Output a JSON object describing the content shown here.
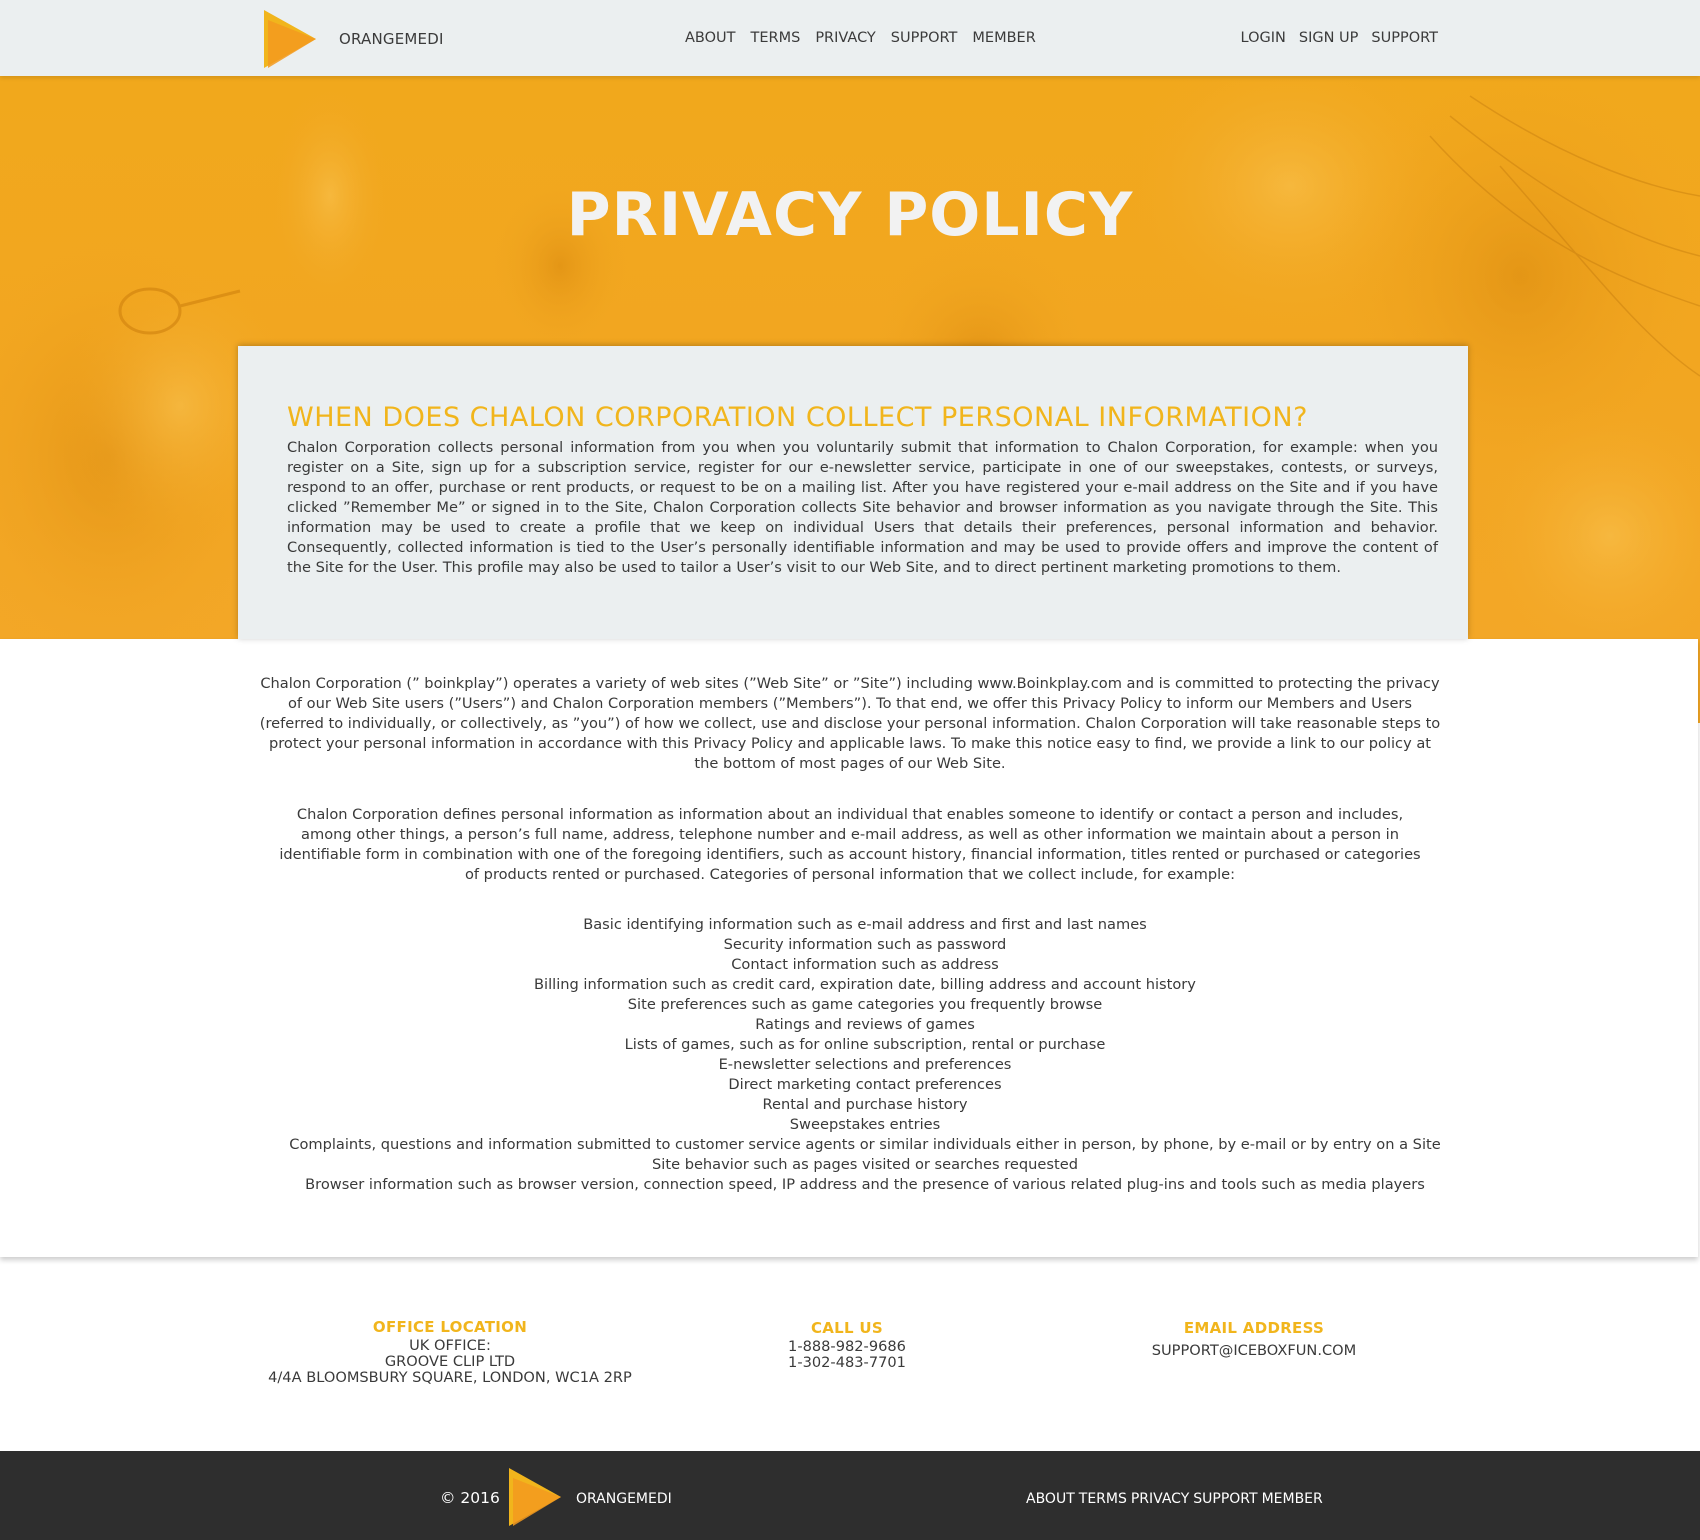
{
  "header": {
    "brand": "ORANGEMEDI",
    "nav_main": [
      "ABOUT",
      "TERMS",
      "PRIVACY",
      "SUPPORT",
      "MEMBER"
    ],
    "nav_right": [
      "LOGIN",
      "SIGN UP",
      "SUPPORT"
    ]
  },
  "hero": {
    "title": "PRIVACY POLICY"
  },
  "intro": {
    "heading": "WHEN DOES CHALON CORPORATION COLLECT PERSONAL INFORMATION?",
    "text": "Chalon Corporation collects personal information from you when you voluntarily submit that information to Chalon Corporation, for example: when you register on a Site, sign up for a subscription service, register for our e-newsletter service, participate in one of our sweepstakes, contests, or surveys, respond to an offer, purchase or rent products, or request to be on a mailing list. After you have registered your e-mail address on the Site and if you have clicked ”Remember Me” or signed in to the Site, Chalon Corporation collects Site behavior and browser information as you navigate through the Site. This information may be used to create a profile that we keep on individual Users that details their preferences, personal information and behavior. Consequently, collected information is tied to the User’s personally identifiable information and may be used to provide offers and improve the content of the Site for the User. This profile may also be used to tailor a User’s visit to our Web Site, and to direct pertinent marketing promotions to them."
  },
  "body": {
    "paragraph_1": "Chalon Corporation (” boinkplay”) operates a variety of web sites (”Web Site” or ”Site”) including www.Boinkplay.com and is committed to protecting the privacy of our Web Site users (”Users”) and Chalon Corporation members (”Members”). To that end, we offer this Privacy Policy to inform our Members and Users (referred to individually, or collectively, as ”you”) of how we collect, use and disclose your personal information. Chalon Corporation will take reasonable steps to protect your personal information in accordance with this Privacy Policy and applicable laws. To make this notice easy to find, we provide a link to our policy at the bottom of most pages of our Web Site.",
    "paragraph_2": "Chalon Corporation defines personal information as information about an individual that enables someone to identify or contact a person and includes, among other things, a person’s full name, address, telephone number and e-mail address, as well as other information we maintain about a person in identifiable form in combination with one of the foregoing identifiers, such as account history, financial information, titles rented or purchased or categories of products rented or purchased. Categories of personal information that we collect include, for example:",
    "categories": [
      "Basic identifying information such as e-mail address and first and last names",
      "Security information such as password",
      "Contact information such as address",
      "Billing information such as credit card, expiration date, billing address and account history",
      "Site preferences such as game categories you frequently browse",
      "Ratings and reviews of games",
      "Lists of games, such as for online subscription, rental or purchase",
      "E-newsletter selections and preferences",
      "Direct marketing contact preferences",
      "Rental and purchase history",
      "Sweepstakes entries",
      "Complaints, questions and information submitted to customer service agents or similar individuals either in person, by phone, by e-mail or by entry on a Site",
      "Site behavior such as pages visited or searches requested",
      "Browser information such as browser version, connection speed, IP address and the presence of various related plug-ins and tools such as media players"
    ]
  },
  "contact": {
    "office": {
      "title": "OFFICE LOCATION",
      "lines": [
        "UK OFFICE:",
        "GROOVE CLIP LTD",
        "4/4A BLOOMSBURY SQUARE, LONDON, WC1A 2RP"
      ]
    },
    "call": {
      "title": "CALL US",
      "lines": [
        "1-888-982-9686",
        "1-302-483-7701"
      ]
    },
    "email": {
      "title": "EMAIL ADDRESS",
      "value": "SUPPORT@ICEBOXFUN.COM"
    }
  },
  "footer": {
    "copyright": "© 2016",
    "brand": "ORANGEMEDI",
    "nav": [
      "ABOUT",
      "TERMS",
      "PRIVACY",
      "SUPPORT",
      "MEMBER"
    ]
  },
  "colors": {
    "accent": "#f1b51c",
    "hero_orange": "#f2a621",
    "header_bg": "#ebeff0",
    "footer_bg": "#2e2e2e",
    "text": "#3a3a3a"
  },
  "icons": [
    "play-logo-icon"
  ]
}
